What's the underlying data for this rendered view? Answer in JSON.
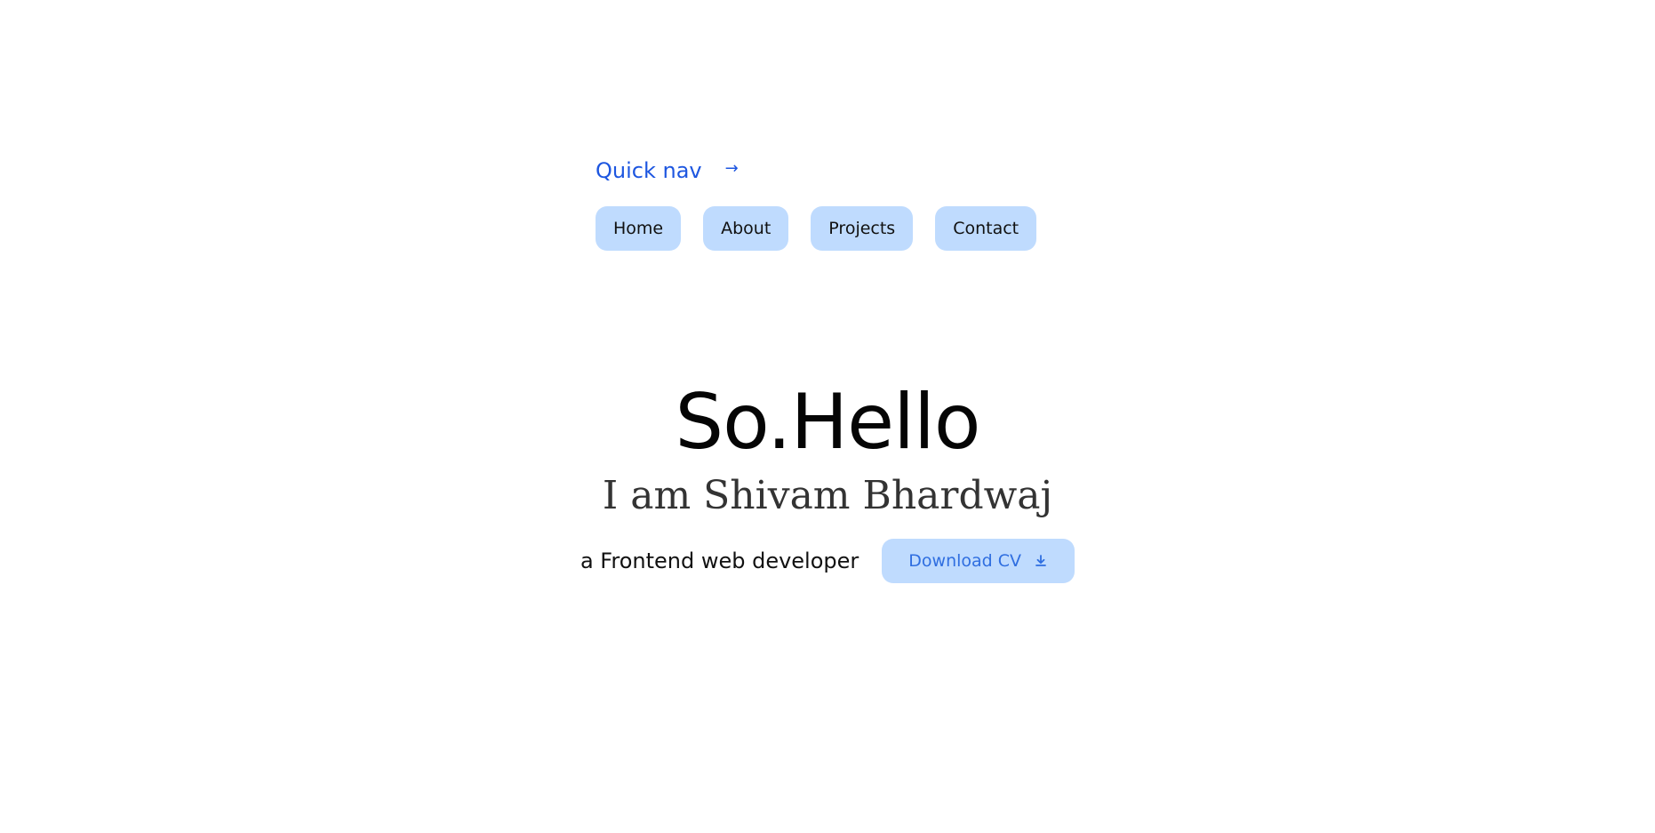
{
  "quick_nav": {
    "title": "Quick nav",
    "arrow_icon": "arrow-right-icon",
    "items": [
      {
        "label": "Home"
      },
      {
        "label": "About"
      },
      {
        "label": "Projects"
      },
      {
        "label": "Contact"
      }
    ]
  },
  "hero": {
    "title": "So.Hello",
    "subtitle": "I am Shivam Bhardwaj",
    "tagline": "a Frontend web developer",
    "download_label": "Download CV",
    "download_icon": "download-icon"
  },
  "colors": {
    "accent": "#1d56e0",
    "button_bg": "#bfdbfe",
    "download_text": "#2f6ee0"
  }
}
